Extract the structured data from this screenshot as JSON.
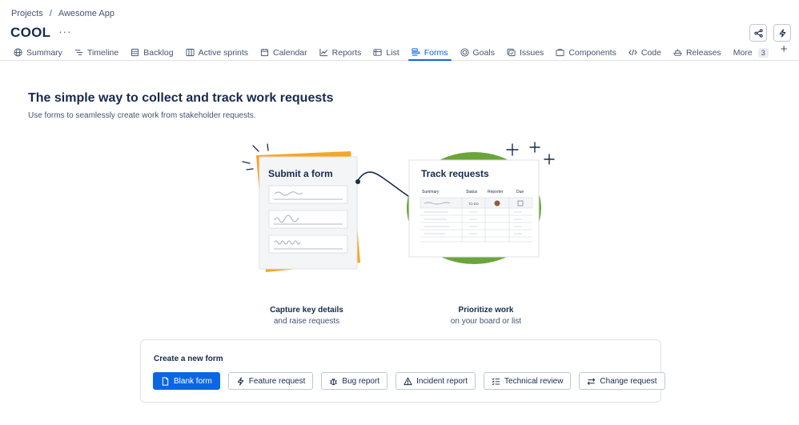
{
  "breadcrumb": {
    "projects": "Projects",
    "separator": "/",
    "app": "Awesome App"
  },
  "project": {
    "title": "COOL",
    "more": "···"
  },
  "tabs": [
    {
      "label": "Summary",
      "icon": "globe-icon"
    },
    {
      "label": "Timeline",
      "icon": "timeline-icon"
    },
    {
      "label": "Backlog",
      "icon": "backlog-icon"
    },
    {
      "label": "Active sprints",
      "icon": "board-icon"
    },
    {
      "label": "Calendar",
      "icon": "calendar-icon"
    },
    {
      "label": "Reports",
      "icon": "chart-line-icon"
    },
    {
      "label": "List",
      "icon": "list-icon"
    },
    {
      "label": "Forms",
      "icon": "forms-icon"
    },
    {
      "label": "Goals",
      "icon": "target-icon"
    },
    {
      "label": "Issues",
      "icon": "issues-icon"
    },
    {
      "label": "Components",
      "icon": "components-icon"
    },
    {
      "label": "Code",
      "icon": "code-icon"
    },
    {
      "label": "Releases",
      "icon": "ship-icon"
    }
  ],
  "more_tab": {
    "label": "More",
    "count": "3"
  },
  "main": {
    "headline": "The simple way to collect and track work requests",
    "subline": "Use forms to seamlessly create work from stakeholder requests."
  },
  "illustration": {
    "submit_title": "Submit a form",
    "track_title": "Track requests",
    "columns": [
      "Summary",
      "Status",
      "Reporter",
      "Due"
    ],
    "status_tag": "TO DO"
  },
  "captions": {
    "left": {
      "strong": "Capture key details",
      "light": "and raise requests"
    },
    "right": {
      "strong": "Prioritize work",
      "light": "on your board or list"
    }
  },
  "create": {
    "title": "Create a new form",
    "buttons": [
      {
        "label": "Blank form",
        "icon": "document-icon"
      },
      {
        "label": "Feature request",
        "icon": "lightning-icon"
      },
      {
        "label": "Bug report",
        "icon": "bug-icon"
      },
      {
        "label": "Incident report",
        "icon": "warning-icon"
      },
      {
        "label": "Technical review",
        "icon": "checklist-icon"
      },
      {
        "label": "Change request",
        "icon": "swap-icon"
      }
    ]
  },
  "colors": {
    "accent": "#0c66e4",
    "orange": "#f5a623",
    "green": "#6aa53a"
  }
}
